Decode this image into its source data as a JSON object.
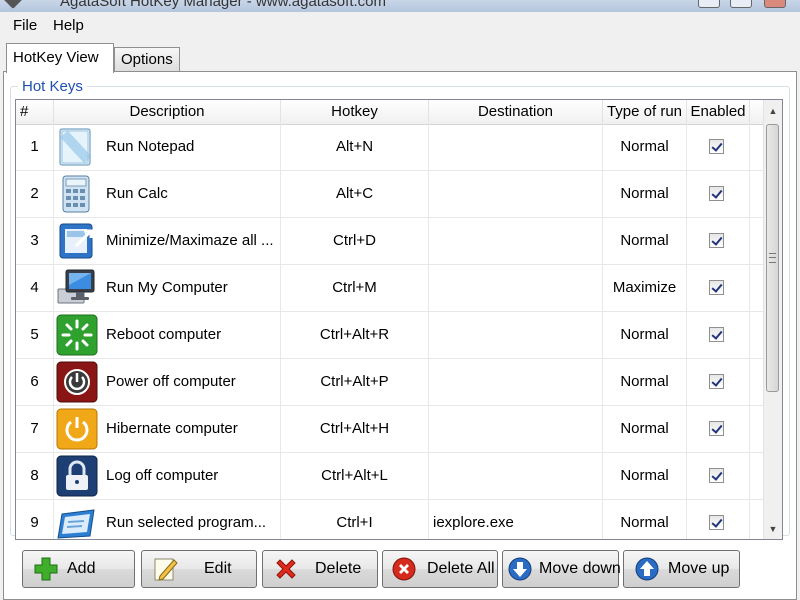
{
  "window": {
    "title": "AgataSoft HotKey Manager  -  www.agatasoft.com"
  },
  "menu": {
    "items": [
      {
        "label": "File"
      },
      {
        "label": "Help"
      }
    ]
  },
  "tabs": [
    {
      "label": "HotKey View",
      "active": true
    },
    {
      "label": "Options",
      "active": false
    }
  ],
  "group": {
    "label": "Hot Keys"
  },
  "table": {
    "columns": [
      "#",
      "Description",
      "Hotkey",
      "Destination",
      "Type of run",
      "Enabled"
    ],
    "rows": [
      {
        "num": "1",
        "icon": "notepad-icon",
        "description": "Run Notepad",
        "hotkey": "Alt+N",
        "destination": "",
        "type": "Normal",
        "enabled": true
      },
      {
        "num": "2",
        "icon": "calculator-icon",
        "description": "Run Calc",
        "hotkey": "Alt+C",
        "destination": "",
        "type": "Normal",
        "enabled": true
      },
      {
        "num": "3",
        "icon": "minimize-windows-icon",
        "description": "Minimize/Maximaze all ...",
        "hotkey": "Ctrl+D",
        "destination": "",
        "type": "Normal",
        "enabled": true
      },
      {
        "num": "4",
        "icon": "my-computer-icon",
        "description": "Run My Computer",
        "hotkey": "Ctrl+M",
        "destination": "",
        "type": "Maximize",
        "enabled": true
      },
      {
        "num": "5",
        "icon": "reboot-icon",
        "description": "Reboot computer",
        "hotkey": "Ctrl+Alt+R",
        "destination": "",
        "type": "Normal",
        "enabled": true
      },
      {
        "num": "6",
        "icon": "power-off-icon",
        "description": "Power off computer",
        "hotkey": "Ctrl+Alt+P",
        "destination": "",
        "type": "Normal",
        "enabled": true
      },
      {
        "num": "7",
        "icon": "hibernate-icon",
        "description": "Hibernate computer",
        "hotkey": "Ctrl+Alt+H",
        "destination": "",
        "type": "Normal",
        "enabled": true
      },
      {
        "num": "8",
        "icon": "lock-icon",
        "description": "Log off computer",
        "hotkey": "Ctrl+Alt+L",
        "destination": "",
        "type": "Normal",
        "enabled": true
      },
      {
        "num": "9",
        "icon": "program-window-icon",
        "description": "Run selected program...",
        "hotkey": "Ctrl+I",
        "destination": "iexplore.exe",
        "type": "Normal",
        "enabled": true
      }
    ]
  },
  "buttons": [
    {
      "label": "Add",
      "icon": "plus-icon"
    },
    {
      "label": "Edit",
      "icon": "pencil-icon"
    },
    {
      "label": "Delete",
      "icon": "red-x-icon"
    },
    {
      "label": "Delete All",
      "icon": "delete-all-icon"
    },
    {
      "label": "Move down",
      "icon": "arrow-down-icon"
    },
    {
      "label": "Move up",
      "icon": "arrow-up-icon"
    }
  ]
}
